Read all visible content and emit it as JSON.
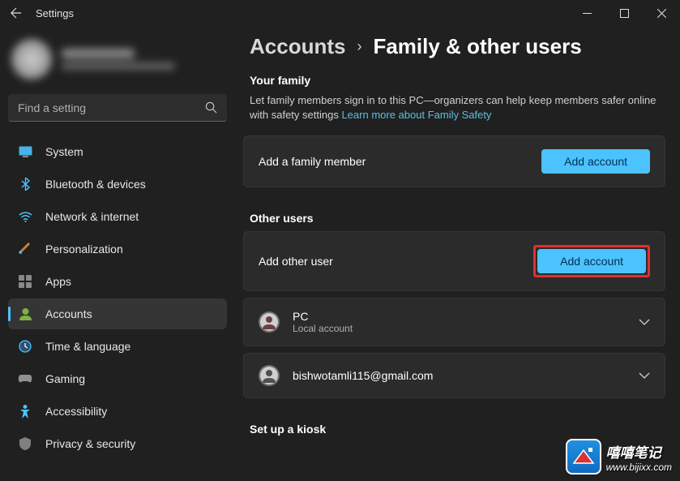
{
  "window": {
    "title": "Settings"
  },
  "search": {
    "placeholder": "Find a setting"
  },
  "nav": {
    "items": [
      {
        "label": "System"
      },
      {
        "label": "Bluetooth & devices"
      },
      {
        "label": "Network & internet"
      },
      {
        "label": "Personalization"
      },
      {
        "label": "Apps"
      },
      {
        "label": "Accounts"
      },
      {
        "label": "Time & language"
      },
      {
        "label": "Gaming"
      },
      {
        "label": "Accessibility"
      },
      {
        "label": "Privacy & security"
      }
    ]
  },
  "breadcrumb": {
    "parent": "Accounts",
    "current": "Family & other users"
  },
  "family": {
    "heading": "Your family",
    "description": "Let family members sign in to this PC—organizers can help keep members safer online with safety settings ",
    "link": "Learn more about Family Safety",
    "add_label": "Add a family member",
    "add_button": "Add account"
  },
  "other": {
    "heading": "Other users",
    "add_label": "Add other user",
    "add_button": "Add account",
    "users": [
      {
        "name": "PC",
        "type": "Local account"
      },
      {
        "name": "bishwotamli115@gmail.com",
        "type": ""
      }
    ]
  },
  "kiosk": {
    "heading": "Set up a kiosk"
  },
  "watermark": {
    "text1": "嘻嘻笔记",
    "text2": "www.bijixx.com"
  }
}
